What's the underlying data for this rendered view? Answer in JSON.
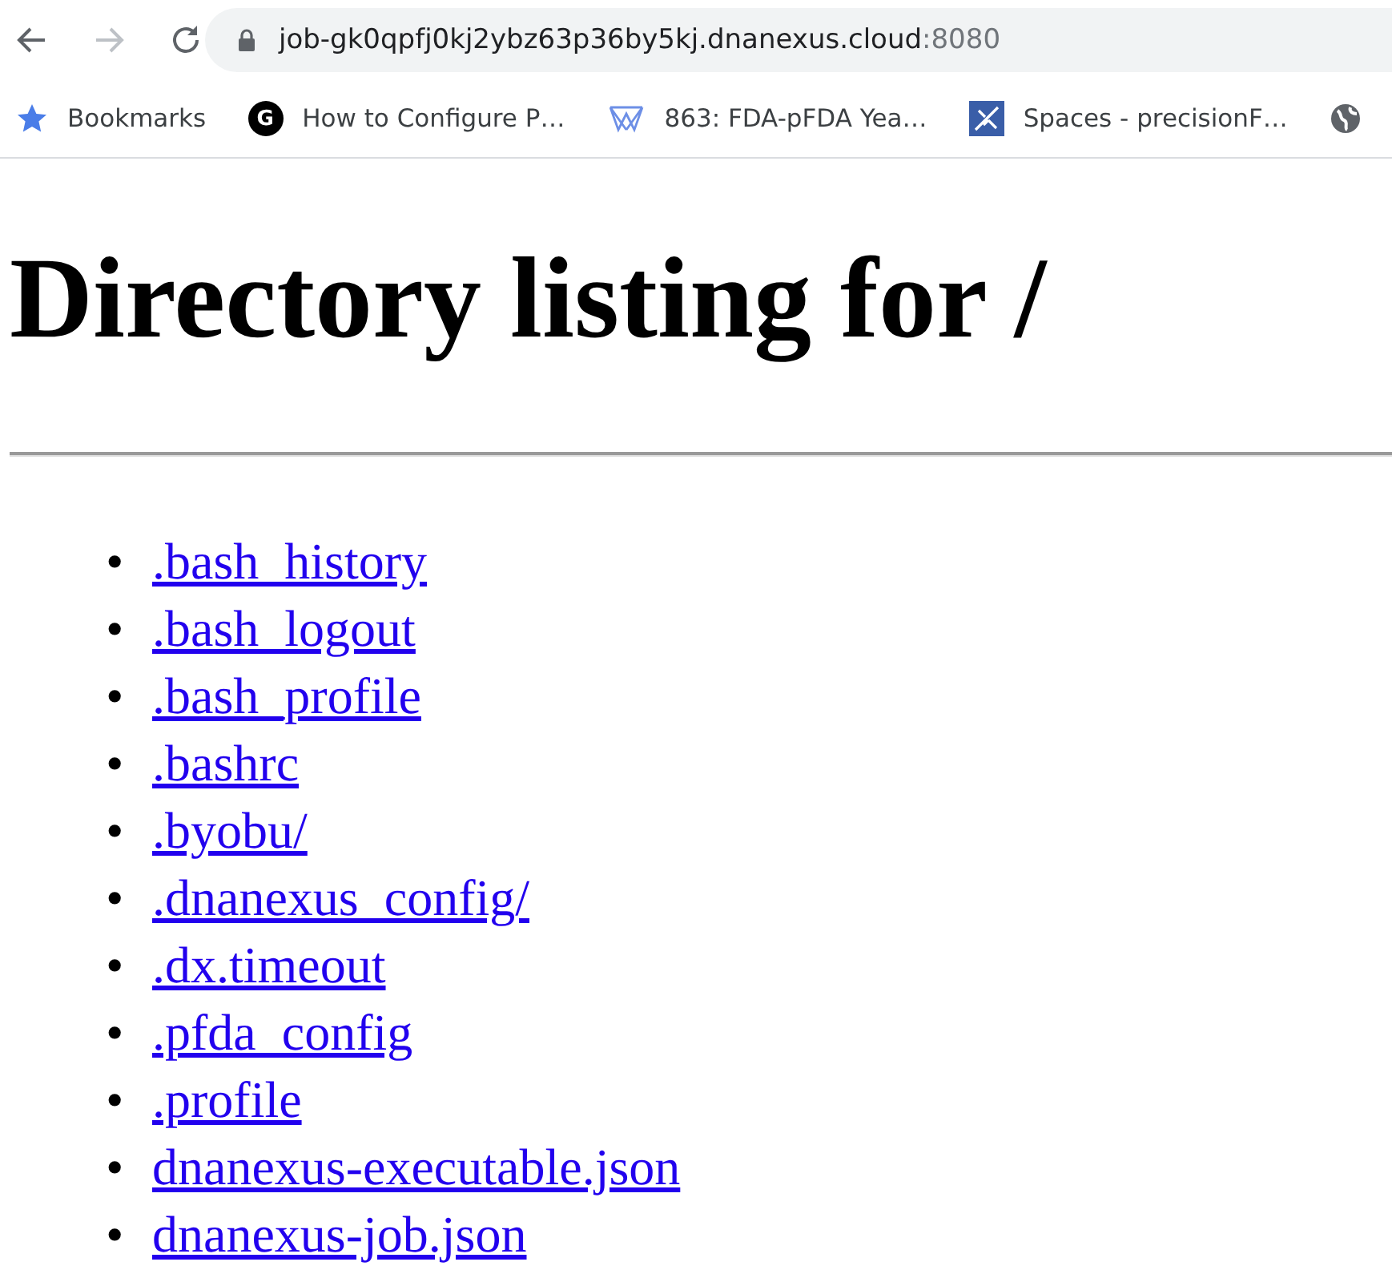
{
  "browser": {
    "url_host": "job-gk0qpfj0kj2ybz63p36by5kj.dnanexus.cloud",
    "url_port": ":8080",
    "bookmarks": [
      {
        "label": "Bookmarks",
        "kind": "star"
      },
      {
        "label": "How to Configure P…",
        "kind": "letter",
        "letter": "G"
      },
      {
        "label": "863: FDA-pFDA Yea…",
        "kind": "mesh"
      },
      {
        "label": "Spaces - precisionF…",
        "kind": "tile"
      },
      {
        "kind": "globe"
      }
    ]
  },
  "page": {
    "heading": "Directory listing for /",
    "entries": [
      {
        "marker": "•",
        "name": ".bash_history"
      },
      {
        "marker": "•",
        "name": ".bash_logout"
      },
      {
        "marker": "•",
        "name": ".bash_profile"
      },
      {
        "marker": "•",
        "name": ".bashrc"
      },
      {
        "marker": "•",
        "name": ".byobu/"
      },
      {
        "marker": "•",
        "name": ".dnanexus_config/"
      },
      {
        "marker": "•",
        "name": ".dx.timeout"
      },
      {
        "marker": "•",
        "name": ".pfda_config"
      },
      {
        "marker": "•",
        "name": ".profile"
      },
      {
        "marker": "•",
        "name": "dnanexus-executable.json"
      },
      {
        "marker": "•",
        "name": "dnanexus-job.json"
      }
    ]
  }
}
